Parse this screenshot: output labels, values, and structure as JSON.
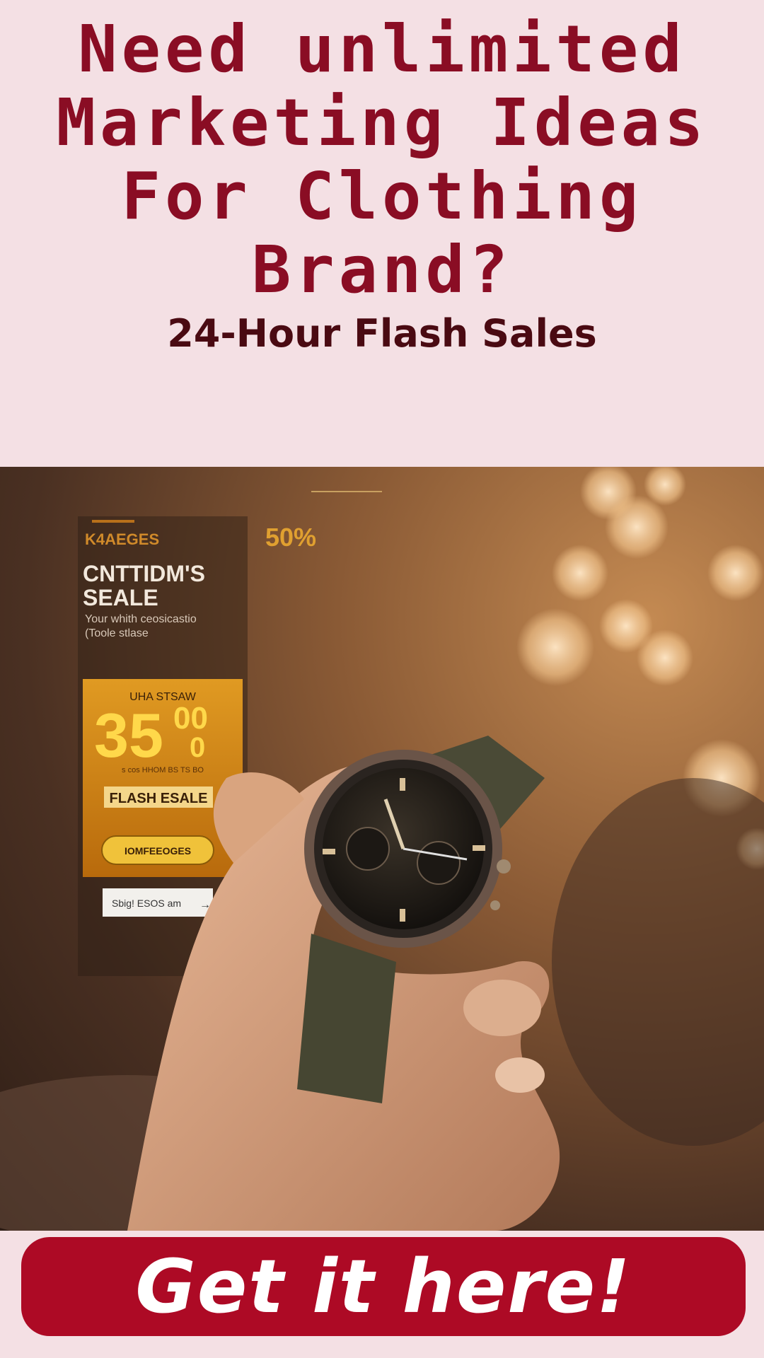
{
  "headline": {
    "lines": [
      "Need unlimited",
      "Marketing Ideas",
      "For Clothing",
      "Brand?"
    ]
  },
  "subheadline": "24-Hour Flash Sales",
  "photo": {
    "ad_overlay": {
      "badge_text": "K4AEGES",
      "discount": "50%",
      "title_line1": "CNTTIDM'S",
      "title_line2": "SEALE",
      "tagline_line1": "Your whith ceosicastio",
      "tagline_line2": "(Toole stlase",
      "card_top": "UHA STSAW",
      "price": "35",
      "price_suffix_top": "00",
      "price_suffix_bottom": "0",
      "small_print": "s cos HHOM BS TS BO",
      "flash_label": "FLASH ESALE",
      "shop_button": "IOMFEEOGES",
      "input_text": "Sbig! ESOS am",
      "input_arrow": "→"
    }
  },
  "cta": {
    "label": "Get it here!"
  },
  "colors": {
    "background": "#f4e0e4",
    "headline": "#8a0d24",
    "subheadline": "#4a0a12",
    "cta": "#ad0a25",
    "ad_gold": "#d4870f"
  }
}
